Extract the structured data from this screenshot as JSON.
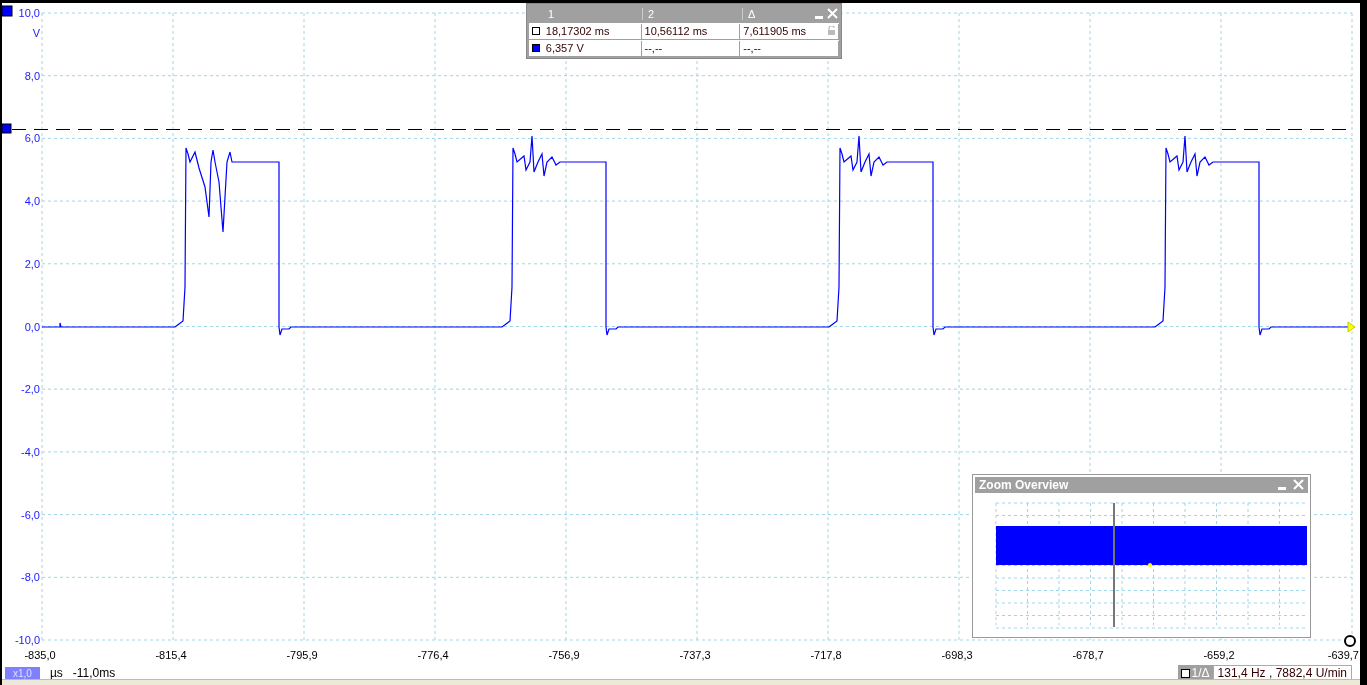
{
  "y_axis": {
    "unit": "V",
    "ticks": [
      "10,0",
      "8,0",
      "6,0",
      "4,0",
      "2,0",
      "0,0",
      "-2,0",
      "-4,0",
      "-6,0",
      "-8,0",
      "-10,0"
    ]
  },
  "x_axis": {
    "ticks": [
      "-835,0",
      "-815,4",
      "-795,9",
      "-776,4",
      "-756,9",
      "-737,3",
      "-717,8",
      "-698,3",
      "-678,7",
      "-659,2",
      "-639,7"
    ]
  },
  "cursor_table": {
    "columns": [
      "1",
      "2",
      "Δ"
    ],
    "rows": [
      {
        "color": "#ffffff",
        "values": [
          "18,17302 ms",
          "10,56112 ms",
          "7,611905 ms"
        ]
      },
      {
        "color": "#0000ff",
        "values": [
          "6,357 V",
          "--,--",
          "--,--"
        ]
      }
    ]
  },
  "zoom_overview": {
    "title": "Zoom Overview"
  },
  "status_bar": {
    "zoom": "x1,0",
    "unit": "µs",
    "offset": "-11,0ms",
    "readout_label": "1/Δ",
    "readout": "131,4 Hz , 7882,4 U/min"
  }
}
